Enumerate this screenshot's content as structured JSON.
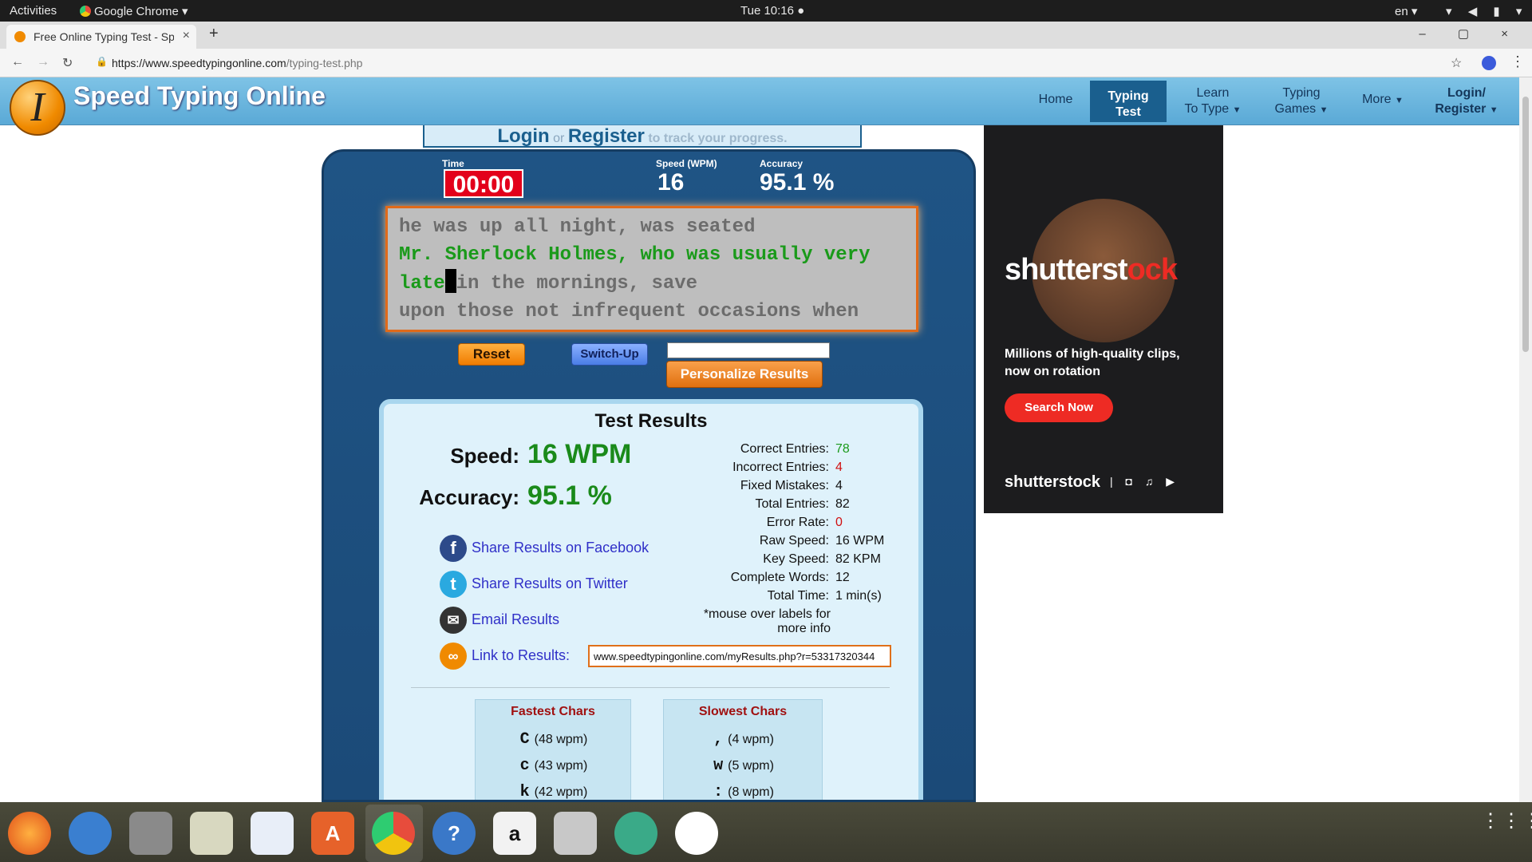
{
  "gnome": {
    "activities": "Activities",
    "app_menu": "Google Chrome ▾",
    "clock": "Tue 10:16 ●",
    "lang": "en ▾",
    "tray": "▾ ◀ ▮ ▾"
  },
  "browser": {
    "tab_title": "Free Online Typing Test - Speed Typing Online",
    "tab_close": "×",
    "new_tab": "+",
    "window_controls": "– ▢ ×",
    "url_host": "https://www.speedtypingonline.com",
    "url_path": "/typing-test.php",
    "lock": "🔒",
    "back": "←",
    "forward": "→",
    "reload": "↻",
    "star": "☆",
    "menu": "⋮"
  },
  "site": {
    "logo_letter": "I",
    "name": "Speed Typing Online",
    "nav": {
      "home": "Home",
      "typing_test_1": "Typing",
      "typing_test_2": "Test",
      "learn_1": "Learn",
      "learn_2": "To Type",
      "games_1": "Typing",
      "games_2": "Games",
      "more": "More",
      "login_1": "Login/",
      "login_2": "Register",
      "caret": "▼"
    },
    "login_strip": {
      "login": "Login",
      "or": "or",
      "register": "Register",
      "tail": "to track your progress."
    }
  },
  "stats": {
    "time_label": "Time",
    "time_value": "00:00",
    "speed_label": "Speed (WPM)",
    "speed_value": "16",
    "accuracy_label": "Accuracy",
    "accuracy_value": "95.1 %"
  },
  "typing_text": {
    "line1": "he was up all night, was seated",
    "line2_typed": "Mr. Sherlock Holmes, who was usually very",
    "line3_typed": "late",
    "line3_rest": "in the mornings, save",
    "line4": "upon those not infrequent occasions when"
  },
  "controls": {
    "reset": "Reset",
    "switch_up": "Switch-Up",
    "personalize": "Personalize Results"
  },
  "results": {
    "title": "Test Results",
    "speed_label": "Speed:",
    "speed_value": "16 WPM",
    "accuracy_label": "Accuracy:",
    "accuracy_value": "95.1 %",
    "share_facebook": "Share Results on Facebook",
    "share_twitter": "Share Results on Twitter",
    "email": "Email Results",
    "link_label": "Link to Results:",
    "link_url": "www.speedtypingonline.com/myResults.php?r=53317320344",
    "details": [
      {
        "label": "Correct Entries:",
        "value": "78"
      },
      {
        "label": "Incorrect Entries:",
        "value": "4"
      },
      {
        "label": "Fixed Mistakes:",
        "value": "4"
      },
      {
        "label": "Total Entries:",
        "value": "82"
      },
      {
        "label": "Error Rate:",
        "value": "0"
      },
      {
        "label": "Raw Speed:",
        "value": "16 WPM"
      },
      {
        "label": "Key Speed:",
        "value": "82 KPM"
      },
      {
        "label": "Complete Words:",
        "value": "12"
      },
      {
        "label": "Total Time:",
        "value": "1 min(s)"
      }
    ],
    "mouse_note": "*mouse over labels for more info",
    "fastest_title": "Fastest Chars",
    "fastest": [
      {
        "ch": "C",
        "wpm": "(48 wpm)"
      },
      {
        "ch": "c",
        "wpm": "(43 wpm)"
      },
      {
        "ch": "k",
        "wpm": "(42 wpm)"
      }
    ],
    "slowest_title": "Slowest Chars",
    "slowest": [
      {
        "ch": ",",
        "wpm": "(4 wpm)"
      },
      {
        "ch": "w",
        "wpm": "(5 wpm)"
      },
      {
        "ch": ":",
        "wpm": "(8 wpm)"
      }
    ]
  },
  "ad": {
    "logo_a": "shutterst",
    "logo_b": "ck",
    "logo_o": "o",
    "text": "Millions of high-quality clips, now on rotation",
    "button": "Search Now",
    "footer": "shutterstock",
    "footer_icons": "| ◘ ♫ ▶"
  },
  "dock": {
    "apps_grid": "⋮⋮⋮"
  }
}
